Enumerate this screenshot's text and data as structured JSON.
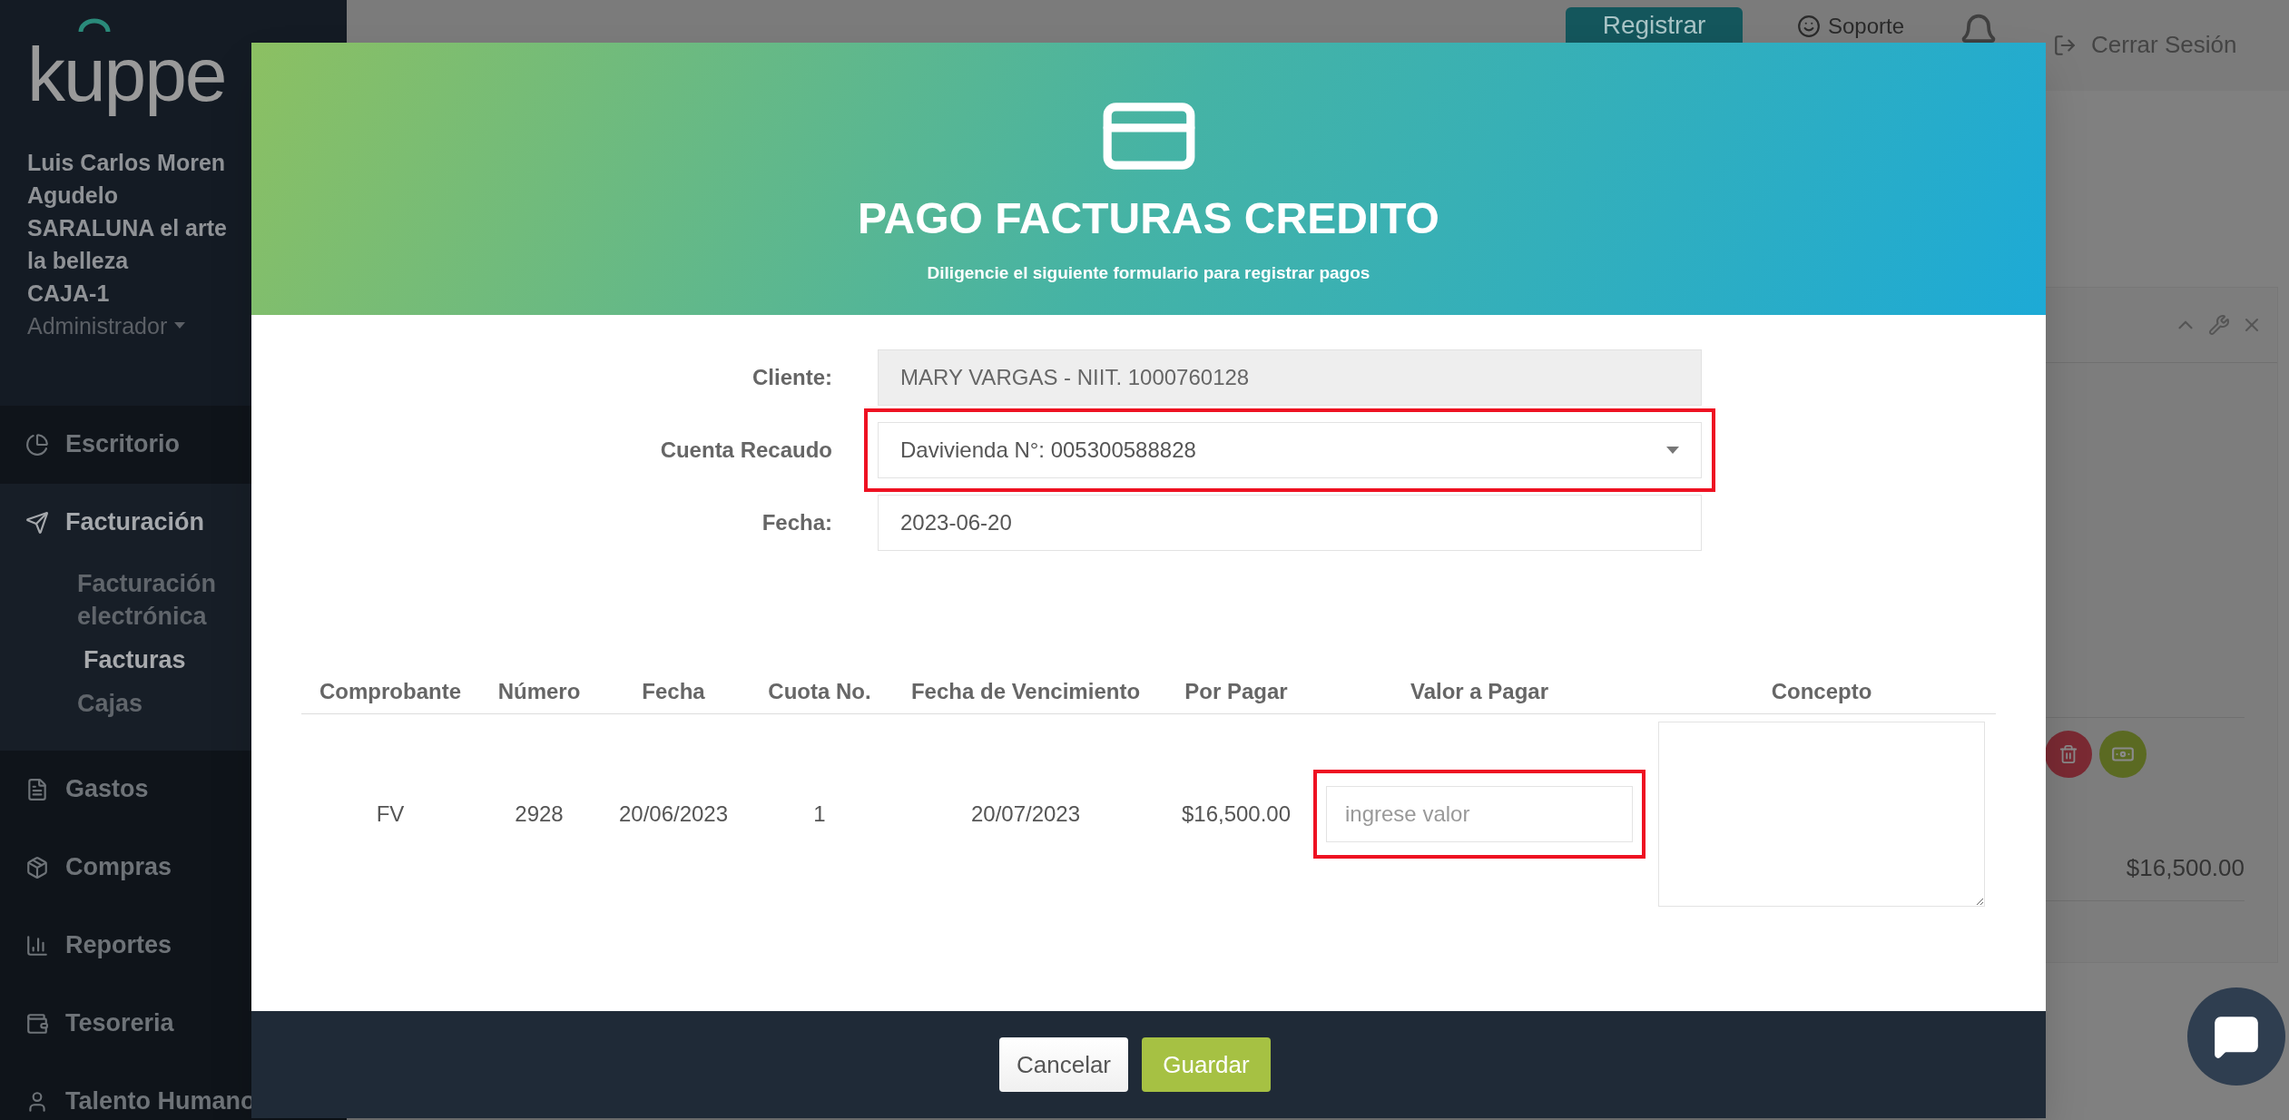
{
  "sidebar": {
    "logo": "kuppe",
    "user_lines": [
      "Luis Carlos Moren",
      "Agudelo",
      "SARALUNA el arte",
      "la belleza",
      "CAJA-1"
    ],
    "role": "Administrador",
    "menu": [
      {
        "label": "Escritorio",
        "expanded": false
      },
      {
        "label": "Facturación",
        "expanded": true,
        "children": [
          {
            "label": "Facturación electrónica",
            "selected": false
          },
          {
            "label": "Facturas",
            "selected": true
          },
          {
            "label": "Cajas",
            "selected": false
          }
        ]
      },
      {
        "label": "Gastos",
        "expanded": false
      },
      {
        "label": "Compras",
        "expanded": false
      },
      {
        "label": "Reportes",
        "expanded": false
      },
      {
        "label": "Tesoreria",
        "expanded": false
      },
      {
        "label": "Talento Humano",
        "expanded": false
      }
    ]
  },
  "topbar": {
    "register_button": "Registrar",
    "support": "Soporte",
    "logout": "Cerrar Sesión"
  },
  "background_card": {
    "amount": "$16,500.00"
  },
  "modal": {
    "title": "PAGO FACTURAS CREDITO",
    "subtitle": "Diligencie el siguiente formulario para registrar pagos",
    "fields": [
      {
        "label": "Cliente:",
        "value": "MARY VARGAS - NIIT. 1000760128",
        "kind": "readonly",
        "highlighted": false
      },
      {
        "label": "Cuenta Recaudo",
        "value": "Davivienda N°: 005300588828",
        "kind": "select",
        "highlighted": true
      },
      {
        "label": "Fecha:",
        "value": "2023-06-20",
        "kind": "text",
        "highlighted": false
      }
    ],
    "table": {
      "columns": [
        "Comprobante",
        "Número",
        "Fecha",
        "Cuota No.",
        "Fecha de Vencimiento",
        "Por Pagar",
        "Valor a Pagar",
        "Concepto"
      ],
      "rows": [
        {
          "cells": [
            "FV",
            "2928",
            "20/06/2023",
            "1",
            "20/07/2023",
            "$16,500.00"
          ],
          "value_input": {
            "placeholder": "ingrese valor",
            "highlighted": true
          }
        }
      ]
    },
    "buttons": [
      {
        "label": "Cancelar",
        "kind": "secondary"
      },
      {
        "label": "Guardar",
        "kind": "primary"
      }
    ]
  }
}
